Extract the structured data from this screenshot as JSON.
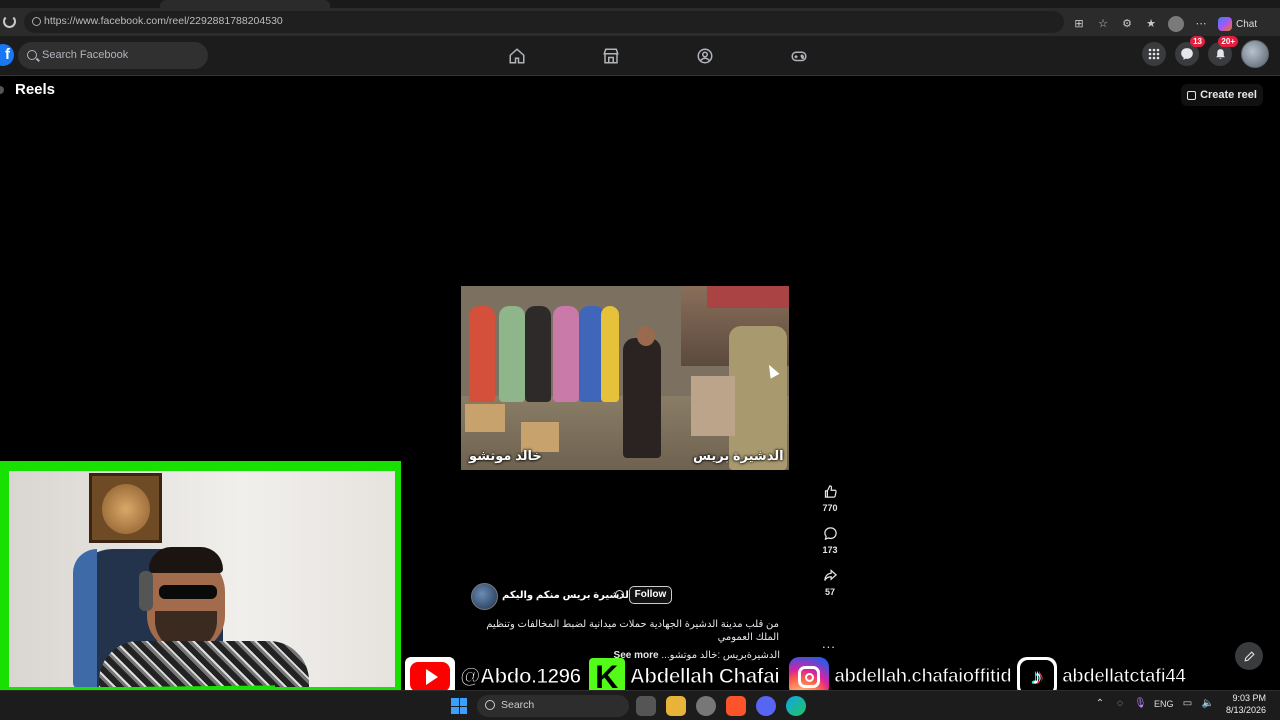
{
  "browser": {
    "url": "https://www.facebook.com/reel/2292881788204530",
    "copilot_label": "Chat",
    "icons": [
      "reload-icon",
      "split-screen-icon",
      "star-icon",
      "extensions-icon",
      "favorites-icon",
      "profile-icon",
      "more-icon",
      "copilot-icon"
    ]
  },
  "fb_nav": {
    "logo": "f",
    "search_placeholder": "Search Facebook",
    "center_icons": [
      "home-icon",
      "marketplace-icon",
      "groups-icon",
      "gaming-icon"
    ],
    "messenger_badge": "13",
    "notifications_badge": "20+"
  },
  "page": {
    "title": "Reels",
    "create_reel_label": "Create reel"
  },
  "reel": {
    "video_caption_left": "خالد موتشو",
    "video_caption_right": "الدشيرة بريس",
    "author_name": "الدشيرة بريس منكم واليكم",
    "follow_label": "Follow",
    "caption": "من قلب مدينة الدشيرة الجهادية حملات ميدانية  لضبط المخالفات وتنظيم الملك العمومي",
    "caption_line2": "الدشيرةبريس :خالد موتشو...",
    "see_more": "See more",
    "likes": "770",
    "comments": "173",
    "shares": "57",
    "more": "..."
  },
  "overlay": {
    "youtube_handle": "@Abdo.1296",
    "kick_letter": "K",
    "kick_handle": "Abdellah Chafai",
    "instagram_handle": "abdellah.chafaioffitid",
    "tiktok_handle": "abdellatctafi44",
    "frame_color": "#18e000"
  },
  "taskbar": {
    "search_label": "Search",
    "language": "ENG",
    "time": "9:03 PM",
    "date": "8/13/2026"
  }
}
